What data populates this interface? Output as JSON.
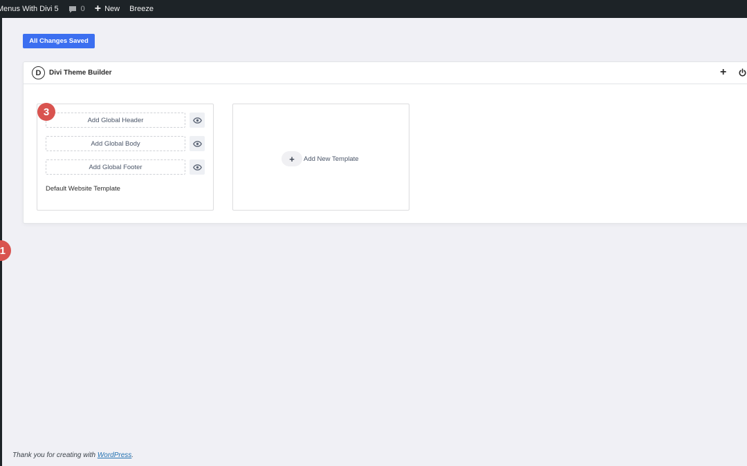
{
  "admin_bar": {
    "site_name": "Menus With Divi 5",
    "comments_count": "0",
    "new_label": "New",
    "breeze_label": "Breeze"
  },
  "step_badges": {
    "left": "1",
    "header_slot": "3"
  },
  "save_button": {
    "label": "All Changes Saved"
  },
  "theme_builder": {
    "logo_letter": "D",
    "title": "Divi Theme Builder",
    "default_template": {
      "slots": [
        {
          "label": "Add Global Header"
        },
        {
          "label": "Add Global Body"
        },
        {
          "label": "Add Global Footer"
        }
      ],
      "name": "Default Website Template"
    },
    "add_new_template": {
      "label": "Add New Template"
    }
  },
  "footer": {
    "prefix": "Thank you for creating with ",
    "link": "WordPress",
    "suffix": "."
  },
  "colors": {
    "admin_bar": "#1d2327",
    "accent_button": "#3c6ff0",
    "badge": "#d9534f",
    "page_bg": "#f0f0f5"
  }
}
